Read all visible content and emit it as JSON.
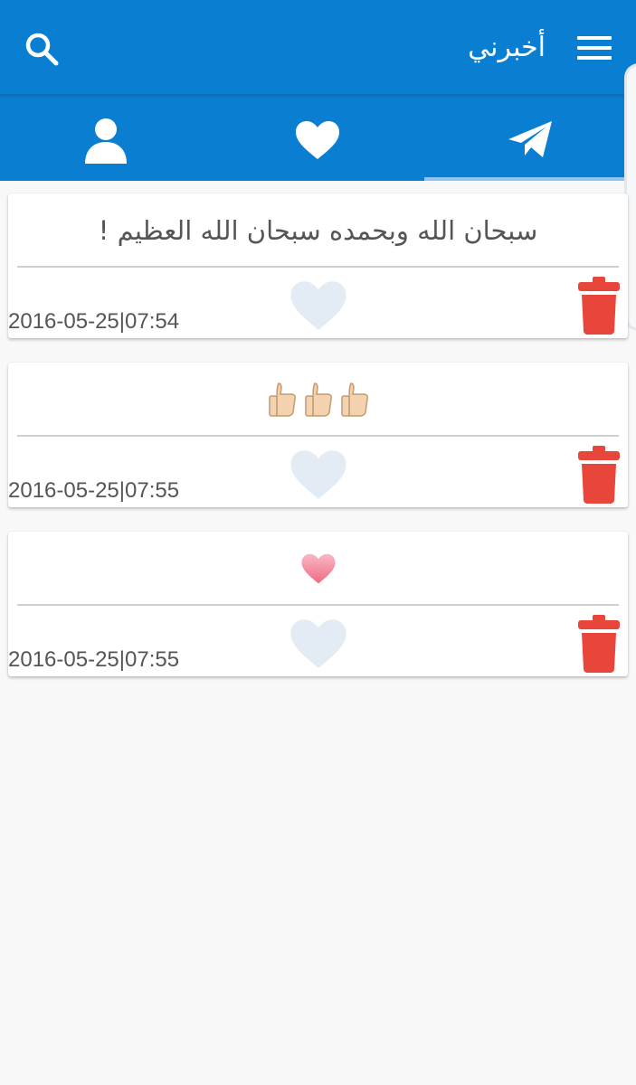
{
  "app": {
    "title": "أخبرني"
  },
  "header": {
    "icons": [
      "search-icon",
      "menu-icon"
    ]
  },
  "tabs": [
    {
      "name": "profile",
      "icon": "person-icon"
    },
    {
      "name": "favorites",
      "icon": "heart-icon"
    },
    {
      "name": "sent",
      "icon": "paper-plane-icon",
      "active": true
    }
  ],
  "colors": {
    "primary": "#0a7fd1",
    "indicator": "#8cc6f0",
    "delete": "#e8463a",
    "like_inactive": "#e3ebf5"
  },
  "messages": [
    {
      "text": "سبحان الله وبحمده سبحان الله العظيم !",
      "timestamp": "2016-05-25|07:54"
    },
    {
      "text": "",
      "emoji": "thumbs-up-icon x3",
      "timestamp": "2016-05-25|07:55"
    },
    {
      "text": "",
      "emoji": "heart-emoji-icon",
      "timestamp": "2016-05-25|07:55"
    }
  ]
}
